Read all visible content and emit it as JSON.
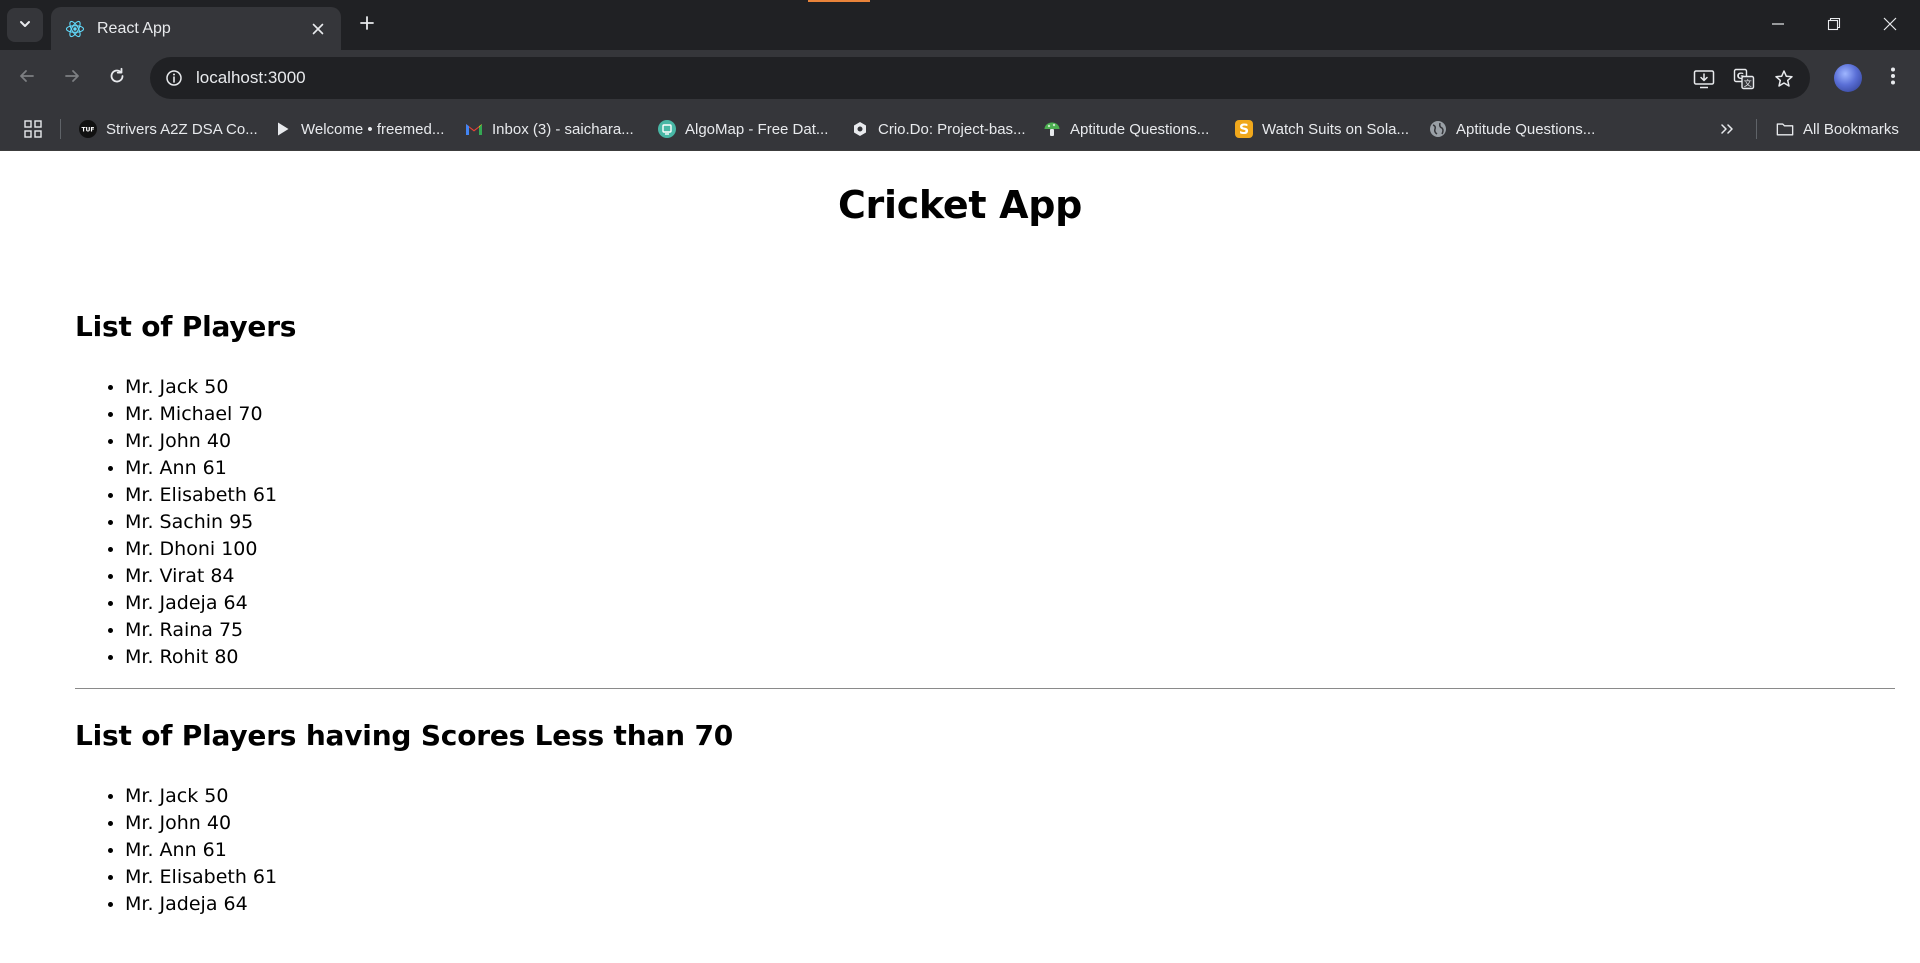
{
  "browser": {
    "tab": {
      "title": "React App"
    },
    "url": "localhost:3000",
    "bookmarks": [
      {
        "label": "Strivers A2Z DSA Co...",
        "icon": "tuf-icon"
      },
      {
        "label": "Welcome • freemed...",
        "icon": "play-icon"
      },
      {
        "label": "Inbox (3) - saichara...",
        "icon": "gmail-icon"
      },
      {
        "label": "AlgoMap - Free Dat...",
        "icon": "algomap-icon"
      },
      {
        "label": "Crio.Do: Project-bas...",
        "icon": "crio-icon"
      },
      {
        "label": "Aptitude Questions...",
        "icon": "mushroom-icon"
      },
      {
        "label": "Watch Suits on Sola...",
        "icon": "solarmovie-icon"
      },
      {
        "label": "Aptitude Questions...",
        "icon": "globe-icon"
      }
    ],
    "all_bookmarks_label": "All Bookmarks"
  },
  "page": {
    "title": "Cricket App",
    "all_players": {
      "heading": "List of Players",
      "items": [
        "Mr. Jack 50",
        "Mr. Michael 70",
        "Mr. John 40",
        "Mr. Ann 61",
        "Mr. Elisabeth 61",
        "Mr. Sachin 95",
        "Mr. Dhoni 100",
        "Mr. Virat 84",
        "Mr. Jadeja 64",
        "Mr. Raina 75",
        "Mr. Rohit 80"
      ]
    },
    "low_scorers": {
      "heading": "List of Players having Scores Less than 70",
      "items": [
        "Mr. Jack 50",
        "Mr. John 40",
        "Mr. Ann 61",
        "Mr. Elisabeth 61",
        "Mr. Jadeja 64"
      ]
    }
  }
}
